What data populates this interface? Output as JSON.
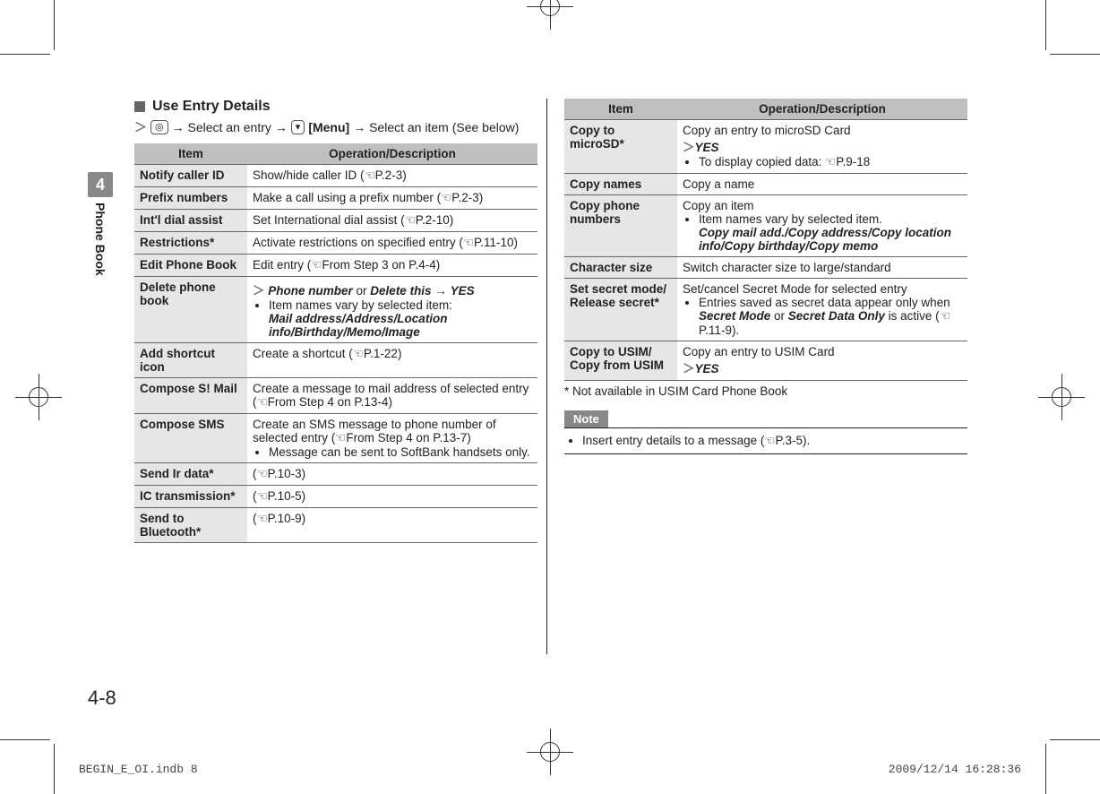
{
  "side": {
    "chapter_num": "4",
    "chapter_label": "Phone Book"
  },
  "heading": "Use Entry Details",
  "nav": {
    "key1": "◎",
    "seg1": "→ Select an entry →",
    "key2": "▾",
    "menu": "[Menu]",
    "seg2": "→ Select an item (See below)"
  },
  "table_headers": {
    "item": "Item",
    "desc": "Operation/Description"
  },
  "left_rows": [
    {
      "item": "Notify caller ID",
      "desc_plain": "Show/hide caller ID (",
      "ref": "P.2-3",
      "tail": ")"
    },
    {
      "item": "Prefix numbers",
      "desc_plain": "Make a call using a prefix number (",
      "ref": "P.2-3",
      "tail": ")"
    },
    {
      "item": "Int'l dial assist",
      "desc_plain": "Set International dial assist (",
      "ref": "P.2-10",
      "tail": ")"
    },
    {
      "item": "Restrictions*",
      "desc_plain": "Activate restrictions on specified entry (",
      "ref": "P.11-10",
      "tail": ")"
    },
    {
      "item": "Edit Phone Book",
      "desc_plain": "Edit entry (",
      "ref": "From Step 3 on P.4-4",
      "tail": ")"
    }
  ],
  "delete_row": {
    "item": "Delete phone book",
    "lead": "Phone number",
    "or": " or ",
    "lead2": "Delete this",
    "arrow": " → ",
    "yes": "YES",
    "bullet": "Item names vary by selected item:",
    "opts": "Mail address/Address/Location info/Birthday/Memo/Image"
  },
  "left_rows2": [
    {
      "item": "Add shortcut icon",
      "desc_plain": "Create a shortcut (",
      "ref": "P.1-22",
      "tail": ")"
    }
  ],
  "compose_mail": {
    "item": "Compose S! Mail",
    "line1": "Create a message to mail address of selected entry (",
    "ref": "From Step 4 on P.13-4",
    "tail": ")"
  },
  "compose_sms": {
    "item": "Compose SMS",
    "line1": "Create an SMS message to phone number of selected entry (",
    "ref": "From Step 4 on P.13-7",
    "tail": ")",
    "bullet": "Message can be sent to SoftBank handsets only."
  },
  "left_rows3": [
    {
      "item": "Send Ir data*",
      "desc_plain": "(",
      "ref": "P.10-3",
      "tail": ")"
    },
    {
      "item": "IC transmission*",
      "desc_plain": "(",
      "ref": "P.10-5",
      "tail": ")"
    },
    {
      "item": "Send to Bluetooth*",
      "desc_plain": "(",
      "ref": "P.10-9",
      "tail": ")"
    }
  ],
  "copy_microsd": {
    "item": "Copy to microSD*",
    "line1": "Copy an entry to microSD Card",
    "yes": "YES",
    "bullet": "To display copied data: ",
    "ref": "P.9-18"
  },
  "copy_names": {
    "item": "Copy names",
    "desc": "Copy a name"
  },
  "copy_phone": {
    "item": "Copy phone numbers",
    "line1": "Copy an item",
    "bullet": "Item names vary by selected item.",
    "opts": "Copy mail add./Copy address/Copy location info/Copy birthday/Copy memo"
  },
  "char_size": {
    "item": "Character size",
    "desc": "Switch character size to large/standard"
  },
  "secret": {
    "item": "Set secret mode/\nRelease secret*",
    "line1": "Set/cancel Secret Mode for selected entry",
    "bullet_pre": "Entries saved as secret data appear only when ",
    "b1": "Secret Mode",
    "or": " or ",
    "b2": "Secret Data Only",
    "bullet_post": " is active (",
    "ref": "P.11-9",
    "tail": ")."
  },
  "copy_usim": {
    "item": "Copy to USIM/\nCopy from USIM",
    "line1": "Copy an entry to USIM Card",
    "yes": "YES"
  },
  "footnote": "* Not available in USIM Card Phone Book",
  "note": {
    "label": "Note",
    "body_pre": "Insert entry details to a message (",
    "ref": "P.3-5",
    "body_post": ")."
  },
  "page_number": "4-8",
  "footer": {
    "left": "BEGIN_E_OI.indb   8",
    "right": "2009/12/14   16:28:36"
  }
}
